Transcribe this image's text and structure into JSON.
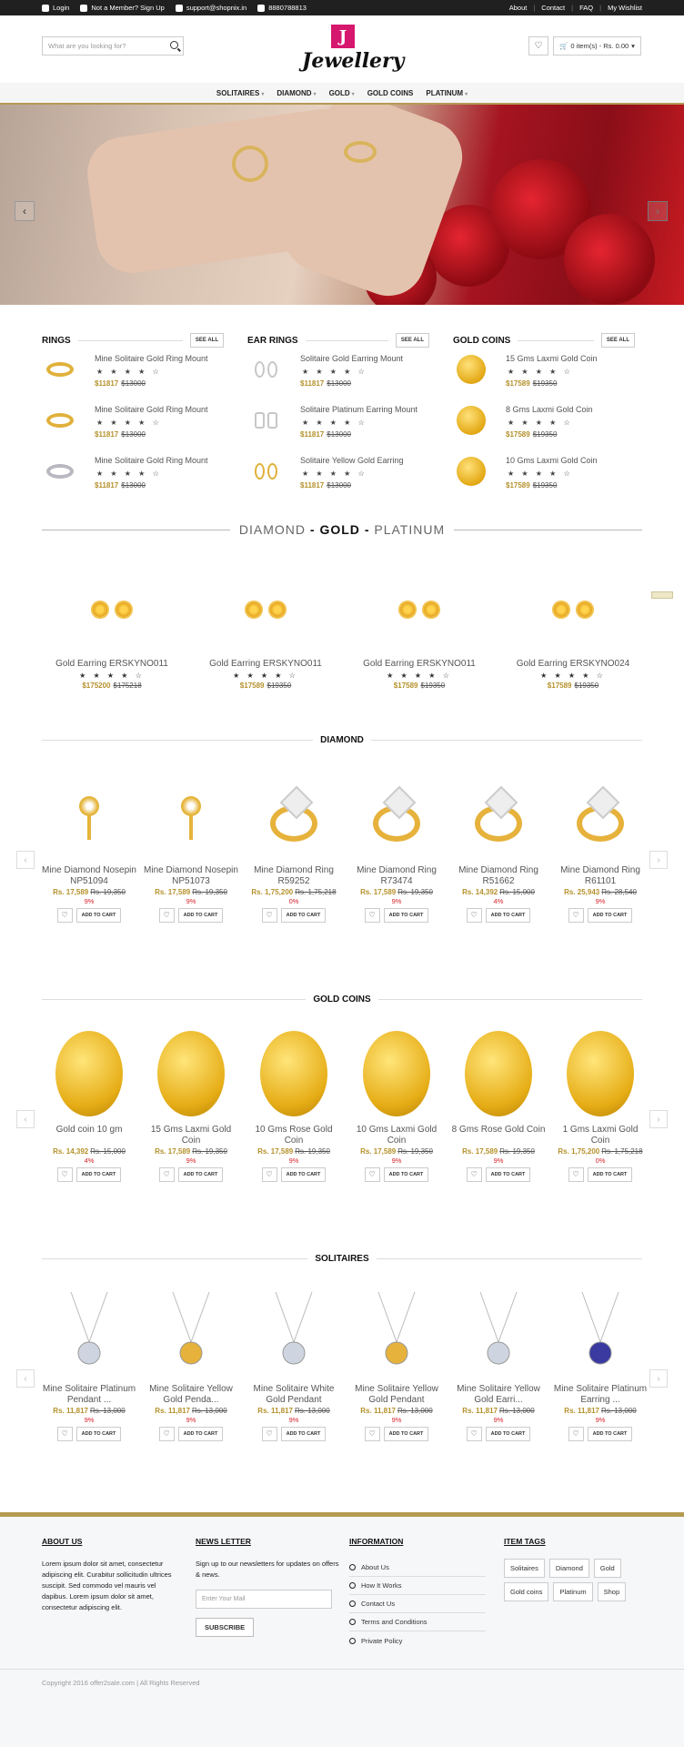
{
  "topbar": {
    "login": "Login",
    "member_prompt": "Not a Member? Sign Up",
    "email": "support@shopnix.in",
    "phone": "8880788813",
    "links": [
      "About",
      "Contact",
      "FAQ",
      "My Wishlist"
    ]
  },
  "search": {
    "placeholder": "What are you looking for?"
  },
  "logo": {
    "letter": "J",
    "text": "Jewellery"
  },
  "cart": {
    "label": "0 item(s) - Rs. 0.00"
  },
  "nav": [
    "SOLITAIRES",
    "DIAMOND",
    "GOLD",
    "GOLD COINS",
    "PLATINUM"
  ],
  "hero": {
    "prev": "‹",
    "next": "›"
  },
  "see_all": "SEE ALL",
  "columns": [
    {
      "title": "RINGS",
      "items": [
        {
          "name": "Mine Solitaire Gold Ring Mount",
          "price": "$11817",
          "old": "$13000"
        },
        {
          "name": "Mine Solitaire Gold Ring Mount",
          "price": "$11817",
          "old": "$13000"
        },
        {
          "name": "Mine Solitaire Gold Ring Mount",
          "price": "$11817",
          "old": "$13000"
        }
      ]
    },
    {
      "title": "EAR RINGS",
      "items": [
        {
          "name": "Solitaire Gold Earring Mount",
          "price": "$11817",
          "old": "$13000"
        },
        {
          "name": "Solitaire Platinum Earring Mount",
          "price": "$11817",
          "old": "$13000"
        },
        {
          "name": "Solitaire Yellow Gold Earring",
          "price": "$11817",
          "old": "$13000"
        }
      ]
    },
    {
      "title": "GOLD COINS",
      "items": [
        {
          "name": "15 Gms Laxmi Gold Coin",
          "price": "$17589",
          "old": "$19350"
        },
        {
          "name": "8 Gms Laxmi Gold Coin",
          "price": "$17589",
          "old": "$19350"
        },
        {
          "name": "10 Gms Laxmi Gold Coin",
          "price": "$17589",
          "old": "$19350"
        }
      ]
    }
  ],
  "stars": "★ ★ ★ ★ ☆",
  "banner": {
    "left": "DIAMOND",
    "dash1": "-",
    "mid": "GOLD",
    "dash2": "-",
    "right": "PLATINUM"
  },
  "earrings": [
    {
      "name": "Gold Earring ERSKYNO011",
      "price": "$175200",
      "old": "$175218"
    },
    {
      "name": "Gold Earring ERSKYNO011",
      "price": "$17589",
      "old": "$19350"
    },
    {
      "name": "Gold Earring ERSKYNO011",
      "price": "$17589",
      "old": "$19350"
    },
    {
      "name": "Gold Earring ERSKYNO024",
      "price": "$17589",
      "old": "$19350"
    }
  ],
  "add_to_cart": "ADD TO CART",
  "heart": "♡",
  "sections": [
    {
      "title": "DIAMOND",
      "items": [
        {
          "name": "Mine Diamond Nosepin NP51094",
          "price": "Rs. 17,589",
          "old": "Rs. 19,350",
          "pct": "9%"
        },
        {
          "name": "Mine Diamond Nosepin NP51073",
          "price": "Rs. 17,589",
          "old": "Rs. 19,350",
          "pct": "9%"
        },
        {
          "name": "Mine Diamond Ring R59252",
          "price": "Rs. 1,75,200",
          "old": "Rs. 1,75,218",
          "pct": "0%"
        },
        {
          "name": "Mine Diamond Ring R73474",
          "price": "Rs. 17,589",
          "old": "Rs. 19,350",
          "pct": "9%"
        },
        {
          "name": "Mine Diamond Ring R51662",
          "price": "Rs. 14,392",
          "old": "Rs. 15,000",
          "pct": "4%"
        },
        {
          "name": "Mine Diamond Ring R61101",
          "price": "Rs. 25,943",
          "old": "Rs. 28,540",
          "pct": "9%"
        }
      ]
    },
    {
      "title": "GOLD COINS",
      "items": [
        {
          "name": "Gold coin 10 gm",
          "price": "Rs. 14,392",
          "old": "Rs. 15,000",
          "pct": "4%"
        },
        {
          "name": "15 Gms Laxmi Gold Coin",
          "price": "Rs. 17,589",
          "old": "Rs. 19,350",
          "pct": "9%"
        },
        {
          "name": "10 Gms Rose Gold Coin",
          "price": "Rs. 17,589",
          "old": "Rs. 19,350",
          "pct": "9%"
        },
        {
          "name": "10 Gms Laxmi Gold Coin",
          "price": "Rs. 17,589",
          "old": "Rs. 19,350",
          "pct": "9%"
        },
        {
          "name": "8 Gms Rose Gold Coin",
          "price": "Rs. 17,589",
          "old": "Rs. 19,350",
          "pct": "9%"
        },
        {
          "name": "1 Gms Laxmi Gold Coin",
          "price": "Rs. 1,75,200",
          "old": "Rs. 1,75,218",
          "pct": "0%"
        }
      ]
    },
    {
      "title": "SOLITAIRES",
      "items": [
        {
          "name": "Mine Solitaire Platinum Pendant ...",
          "price": "Rs. 11,817",
          "old": "Rs. 13,000",
          "pct": "9%"
        },
        {
          "name": "Mine Solitaire Yellow Gold Penda...",
          "price": "Rs. 11,817",
          "old": "Rs. 13,000",
          "pct": "9%"
        },
        {
          "name": "Mine Solitaire White Gold Pendant",
          "price": "Rs. 11,817",
          "old": "Rs. 13,000",
          "pct": "9%"
        },
        {
          "name": "Mine Solitaire Yellow Gold Pendant",
          "price": "Rs. 11,817",
          "old": "Rs. 13,000",
          "pct": "9%"
        },
        {
          "name": "Mine Solitaire Yellow Gold Earri...",
          "price": "Rs. 11,817",
          "old": "Rs. 13,000",
          "pct": "9%"
        },
        {
          "name": "Mine Solitaire Platinum Earring ...",
          "price": "Rs. 11,817",
          "old": "Rs. 13,000",
          "pct": "9%"
        }
      ]
    }
  ],
  "footer": {
    "about_title": "ABOUT US",
    "about_text": "Lorem ipsum dolor sit amet, consectetur adipiscing elit. Curabitur sollicitudin ultrices suscipit. Sed commodo vel mauris vel dapibus. Lorem ipsum dolor sit amet, consectetur adipiscing elit.",
    "news_title": "NEWS LETTER",
    "news_text": "Sign up to our newsletters for updates on offers & news.",
    "mail_placeholder": "Enter Your Mail",
    "subscribe": "SUBSCRIBE",
    "info_title": "INFORMATION",
    "info_links": [
      "About Us",
      "How It Works",
      "Contact Us",
      "Terms and Conditions",
      "Private Policy"
    ],
    "tags_title": "ITEM TAGS",
    "tags": [
      "Solitaires",
      "Diamond",
      "Gold",
      "Gold coins",
      "Platinum",
      "Shop"
    ],
    "copyright": "Copyright 2016 offer2sale.com | All Rights Reserved"
  }
}
